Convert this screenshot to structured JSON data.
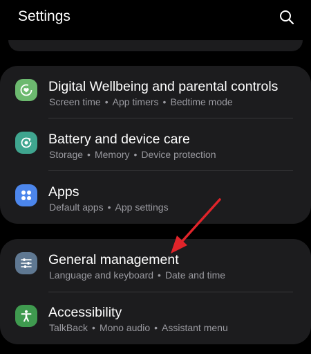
{
  "header": {
    "title": "Settings",
    "search_icon": "search-icon"
  },
  "colors": {
    "background": "#000000",
    "card": "#1c1c1e",
    "subtitle": "#9a9aa0",
    "wellbeing_icon": "#6cb96f",
    "battery_icon": "#3fa58f",
    "apps_icon": "#4c86ec",
    "general_icon": "#5f7892",
    "accessibility_icon": "#3f9a4f",
    "annotation_arrow": "#e0242a"
  },
  "groups": [
    {
      "items": [
        {
          "icon": "digital-wellbeing-icon",
          "title": "Digital Wellbeing and parental controls",
          "subtitles": [
            "Screen time",
            "App timers",
            "Bedtime mode"
          ]
        },
        {
          "icon": "battery-device-care-icon",
          "title": "Battery and device care",
          "subtitles": [
            "Storage",
            "Memory",
            "Device protection"
          ]
        },
        {
          "icon": "apps-grid-icon",
          "title": "Apps",
          "subtitles": [
            "Default apps",
            "App settings"
          ]
        }
      ]
    },
    {
      "items": [
        {
          "icon": "general-management-sliders-icon",
          "title": "General management",
          "subtitles": [
            "Language and keyboard",
            "Date and time"
          ]
        },
        {
          "icon": "accessibility-person-icon",
          "title": "Accessibility",
          "subtitles": [
            "TalkBack",
            "Mono audio",
            "Assistant menu"
          ]
        }
      ]
    }
  ]
}
